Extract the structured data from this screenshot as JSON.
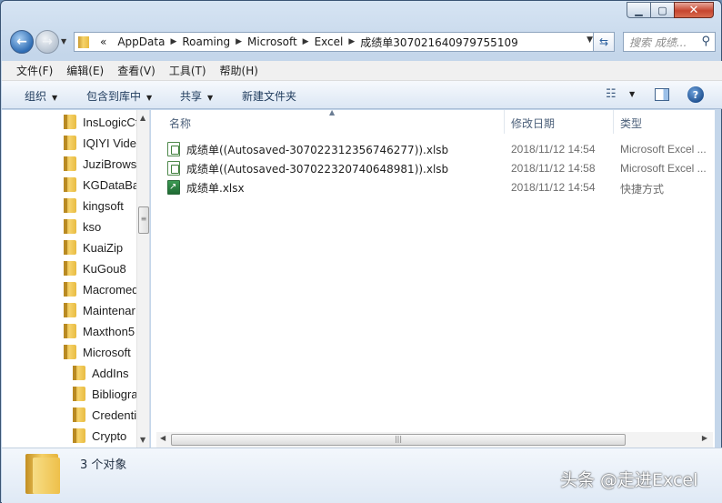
{
  "window": {
    "minimize_icon": "minimize-icon",
    "maximize_icon": "maximize-icon",
    "close_icon": "close-icon"
  },
  "address": {
    "overflow_marker": "«",
    "segments": [
      "AppData",
      "Roaming",
      "Microsoft",
      "Excel",
      "成绩单307021640979755109"
    ]
  },
  "search": {
    "placeholder": "搜索 成绩..."
  },
  "menubar": {
    "items": [
      "文件(F)",
      "编辑(E)",
      "查看(V)",
      "工具(T)",
      "帮助(H)"
    ]
  },
  "commandbar": {
    "organize": "组织",
    "include_in_library": "包含到库中",
    "share": "共享",
    "new_folder": "新建文件夹"
  },
  "tree": {
    "items": [
      {
        "label": "InsLogicCf",
        "indent": 0
      },
      {
        "label": "IQIYI Vide",
        "indent": 0
      },
      {
        "label": "JuziBrowse",
        "indent": 0
      },
      {
        "label": "KGDataBa",
        "indent": 0
      },
      {
        "label": "kingsoft",
        "indent": 0
      },
      {
        "label": "kso",
        "indent": 0
      },
      {
        "label": "KuaiZip",
        "indent": 0
      },
      {
        "label": "KuGou8",
        "indent": 0
      },
      {
        "label": "Macromed",
        "indent": 0
      },
      {
        "label": "Maintenar",
        "indent": 0
      },
      {
        "label": "Maxthon5",
        "indent": 0
      },
      {
        "label": "Microsoft",
        "indent": 0
      },
      {
        "label": "AddIns",
        "indent": 1
      },
      {
        "label": "Bibliogra",
        "indent": 1
      },
      {
        "label": "Credenti",
        "indent": 1
      },
      {
        "label": "Crypto",
        "indent": 1
      }
    ]
  },
  "columns": {
    "name": "名称",
    "modified": "修改日期",
    "type": "类型"
  },
  "files": [
    {
      "name": "成绩单((Autosaved-307022312356746277)).xlsb",
      "modified": "2018/11/12 14:54",
      "type": "Microsoft Excel ...",
      "icon": "excel-file-icon"
    },
    {
      "name": "成绩单((Autosaved-307022320740648981)).xlsb",
      "modified": "2018/11/12 14:58",
      "type": "Microsoft Excel ...",
      "icon": "excel-file-icon"
    },
    {
      "name": "成绩单.xlsx",
      "modified": "2018/11/12 14:54",
      "type": "快捷方式",
      "icon": "shortcut-icon"
    }
  ],
  "details": {
    "count": "3 个对象"
  },
  "watermark": "头条 @走进Excel"
}
